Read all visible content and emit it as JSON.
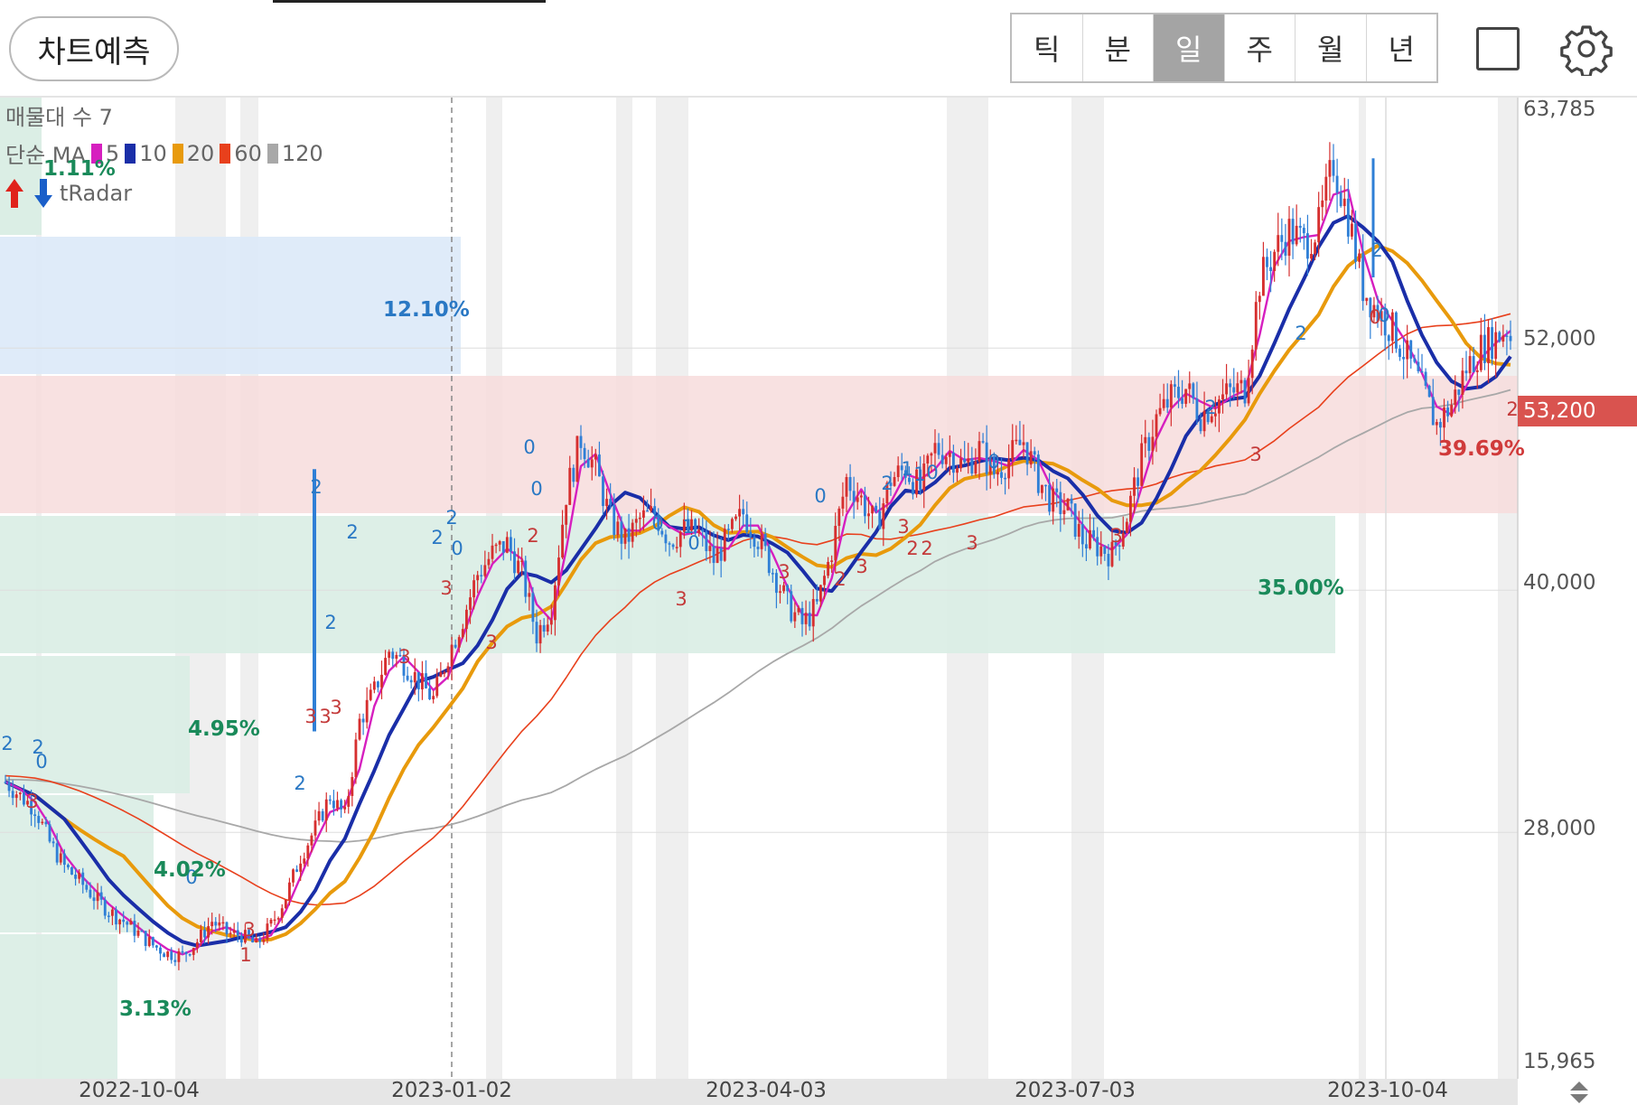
{
  "toolbar": {
    "predict_label": "차트예측",
    "period_tabs": [
      {
        "label": "틱",
        "active": false
      },
      {
        "label": "분",
        "active": false
      },
      {
        "label": "일",
        "active": true
      },
      {
        "label": "주",
        "active": false
      },
      {
        "label": "월",
        "active": false
      },
      {
        "label": "년",
        "active": false
      }
    ],
    "icons": [
      "square-icon",
      "gear-icon"
    ]
  },
  "legend": {
    "volume_profile": "매물대 수 7",
    "ma_label": "단순 MA",
    "ma_periods": [
      "5",
      "10",
      "20",
      "60",
      "120"
    ],
    "ma_colors": [
      "#d61fbf",
      "#1a2ea8",
      "#e89a0c",
      "#e8401c",
      "#a8a8a8"
    ],
    "radar_label": "tRadar"
  },
  "colors": {
    "up": "#d62f2f",
    "down": "#2f7fd6",
    "zone_blue": "#dbe9f8",
    "zone_red": "#f7dcdc",
    "zone_green": "#d9ede4",
    "price_badge": "#d9534f"
  },
  "zone_labels": {
    "top_left": "1.11%",
    "blue": "12.10%",
    "red": "39.69%",
    "green": "35.00%",
    "left_a": "4.95%",
    "left_b": "4.02%",
    "left_c": "3.13%"
  },
  "price_badge": "53,200",
  "chart_data": {
    "type": "candlestick",
    "y_ticks": [
      "63,785",
      "52,000",
      "40,000",
      "28,000",
      "15,965"
    ],
    "ylim": [
      15965,
      63785
    ],
    "x_ticks": [
      "2022-10-04",
      "2023-01-02",
      "2023-04-03",
      "2023-07-03",
      "2023-10-04"
    ],
    "last_price": 53200,
    "ma_periods": [
      5,
      10,
      20,
      60,
      120
    ],
    "close_series": [
      30500,
      29800,
      29200,
      27500,
      26300,
      25600,
      24800,
      24100,
      23600,
      23000,
      22400,
      22000,
      21900,
      22600,
      23600,
      23000,
      22900,
      22400,
      23400,
      24800,
      26800,
      28200,
      29800,
      28800,
      33500,
      35000,
      37000,
      36400,
      35500,
      34600,
      36800,
      38600,
      40800,
      41800,
      42300,
      40800,
      37800,
      39200,
      44800,
      47500,
      46000,
      43500,
      42400,
      43500,
      43800,
      42500,
      43000,
      42800,
      41500,
      42600,
      43800,
      42600,
      41000,
      39300,
      38300,
      39200,
      42000,
      45500,
      44500,
      43200,
      45500,
      46000,
      45000,
      47000,
      46800,
      46100,
      47000,
      45800,
      46500,
      47400,
      45500,
      44300,
      44000,
      42500,
      42200,
      41800,
      43700,
      46500,
      48500,
      49500,
      50000,
      48700,
      49300,
      49800,
      50000,
      55300,
      56800,
      57800,
      57200,
      58000,
      61200,
      58500,
      55000,
      53800,
      52900,
      51500,
      50000,
      48200,
      49200,
      51000,
      52000,
      52500,
      53200
    ]
  }
}
